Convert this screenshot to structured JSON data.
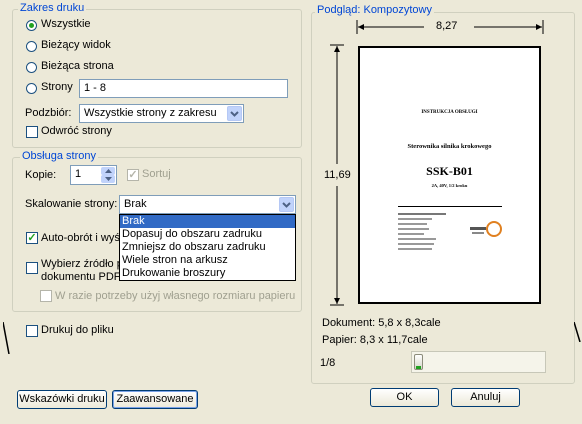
{
  "print_range": {
    "title": "Zakres druku",
    "options": [
      "Wszystkie",
      "Bieżący widok",
      "Bieżąca strona",
      "Strony"
    ],
    "selected": "Wszystkie",
    "pages_value": "1 - 8",
    "subset_label": "Podzbiór:",
    "subset_value": "Wszystkie strony z zakresu",
    "reverse_label": "Odwróć strony"
  },
  "page_handling": {
    "title": "Obsługa strony",
    "copies_label": "Kopie:",
    "copies_value": "1",
    "collate_label": "Sortuj",
    "scaling_label": "Skalowanie strony:",
    "scaling_value": "Brak",
    "scaling_options": [
      "Brak",
      "Dopasuj do obszaru zadruku",
      "Zmniejsz do obszaru zadruku",
      "Wiele stron na arkusz",
      "Drukowanie broszury"
    ],
    "autorotate_label": "Auto-obrót i wyś",
    "choose_source_line1": "Wybierz źródło p",
    "choose_source_line2": "dokumentu PDF",
    "custom_size_label": "W razie potrzeby użyj własnego rozmiaru papieru"
  },
  "print_to_file_label": "Drukuj do pliku",
  "preview": {
    "title": "Podgląd: Kompozytowy",
    "width_label": "8,27",
    "height_label": "11,69",
    "document_size": "Dokument: 5,8 x 8,3cale",
    "paper_size": "Papier: 8,3 x 11,7cale",
    "page_indicator": "1/8",
    "page_position": 0.0,
    "doc": {
      "header": "INSTRUKCJA OBSŁUGI",
      "subtitle": "Sterownika silnika krokowego",
      "model": "SSK-B01",
      "spec": "2A, 40V, 1/2 kroku"
    }
  },
  "buttons": {
    "tips": "Wskazówki druku",
    "advanced": "Zaawansowane",
    "ok": "OK",
    "cancel": "Anuluj"
  }
}
